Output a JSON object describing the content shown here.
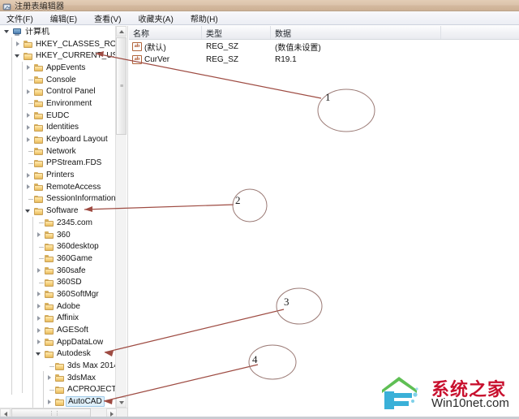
{
  "window": {
    "title": "注册表编辑器",
    "icon": "registry-editor-icon"
  },
  "menubar": {
    "items": [
      {
        "label": "文件(F)",
        "name": "menu-file"
      },
      {
        "label": "编辑(E)",
        "name": "menu-edit"
      },
      {
        "label": "查看(V)",
        "name": "menu-view"
      },
      {
        "label": "收藏夹(A)",
        "name": "menu-favorites"
      },
      {
        "label": "帮助(H)",
        "name": "menu-help"
      }
    ]
  },
  "tree": {
    "items": [
      {
        "label": "计算机",
        "indent": 0,
        "state": "expanded",
        "icon": "computer-icon",
        "selected": false
      },
      {
        "label": "HKEY_CLASSES_ROOT",
        "indent": 1,
        "state": "collapsed",
        "icon": "folder-icon",
        "selected": false
      },
      {
        "label": "HKEY_CURRENT_USER",
        "indent": 1,
        "state": "expanded",
        "icon": "folder-icon",
        "selected": false
      },
      {
        "label": "AppEvents",
        "indent": 2,
        "state": "collapsed",
        "icon": "folder-icon",
        "selected": false
      },
      {
        "label": "Console",
        "indent": 2,
        "state": "leaf",
        "icon": "folder-icon",
        "selected": false
      },
      {
        "label": "Control Panel",
        "indent": 2,
        "state": "collapsed",
        "icon": "folder-icon",
        "selected": false
      },
      {
        "label": "Environment",
        "indent": 2,
        "state": "leaf",
        "icon": "folder-icon",
        "selected": false
      },
      {
        "label": "EUDC",
        "indent": 2,
        "state": "collapsed",
        "icon": "folder-icon",
        "selected": false
      },
      {
        "label": "Identities",
        "indent": 2,
        "state": "collapsed",
        "icon": "folder-icon",
        "selected": false
      },
      {
        "label": "Keyboard Layout",
        "indent": 2,
        "state": "collapsed",
        "icon": "folder-icon",
        "selected": false
      },
      {
        "label": "Network",
        "indent": 2,
        "state": "leaf",
        "icon": "folder-icon",
        "selected": false
      },
      {
        "label": "PPStream.FDS",
        "indent": 2,
        "state": "leaf",
        "icon": "folder-icon",
        "selected": false
      },
      {
        "label": "Printers",
        "indent": 2,
        "state": "collapsed",
        "icon": "folder-icon",
        "selected": false
      },
      {
        "label": "RemoteAccess",
        "indent": 2,
        "state": "collapsed",
        "icon": "folder-icon",
        "selected": false
      },
      {
        "label": "SessionInformation",
        "indent": 2,
        "state": "leaf",
        "icon": "folder-icon",
        "selected": false
      },
      {
        "label": "Software",
        "indent": 2,
        "state": "expanded",
        "icon": "folder-icon",
        "selected": false
      },
      {
        "label": "2345.com",
        "indent": 3,
        "state": "leaf",
        "icon": "folder-icon",
        "selected": false
      },
      {
        "label": "360",
        "indent": 3,
        "state": "collapsed",
        "icon": "folder-icon",
        "selected": false
      },
      {
        "label": "360desktop",
        "indent": 3,
        "state": "leaf",
        "icon": "folder-icon",
        "selected": false
      },
      {
        "label": "360Game",
        "indent": 3,
        "state": "leaf",
        "icon": "folder-icon",
        "selected": false
      },
      {
        "label": "360safe",
        "indent": 3,
        "state": "collapsed",
        "icon": "folder-icon",
        "selected": false
      },
      {
        "label": "360SD",
        "indent": 3,
        "state": "leaf",
        "icon": "folder-icon",
        "selected": false
      },
      {
        "label": "360SoftMgr",
        "indent": 3,
        "state": "collapsed",
        "icon": "folder-icon",
        "selected": false
      },
      {
        "label": "Adobe",
        "indent": 3,
        "state": "collapsed",
        "icon": "folder-icon",
        "selected": false
      },
      {
        "label": "Affinix",
        "indent": 3,
        "state": "collapsed",
        "icon": "folder-icon",
        "selected": false
      },
      {
        "label": "AGESoft",
        "indent": 3,
        "state": "collapsed",
        "icon": "folder-icon",
        "selected": false
      },
      {
        "label": "AppDataLow",
        "indent": 3,
        "state": "collapsed",
        "icon": "folder-icon",
        "selected": false
      },
      {
        "label": "Autodesk",
        "indent": 3,
        "state": "expanded",
        "icon": "folder-icon",
        "selected": false
      },
      {
        "label": "3ds Max 2014",
        "indent": 4,
        "state": "leaf",
        "icon": "folder-icon",
        "selected": false
      },
      {
        "label": "3dsMax",
        "indent": 4,
        "state": "collapsed",
        "icon": "folder-icon",
        "selected": false
      },
      {
        "label": "ACPROJECT",
        "indent": 4,
        "state": "leaf",
        "icon": "folder-icon",
        "selected": false
      },
      {
        "label": "AutoCAD",
        "indent": 4,
        "state": "collapsed",
        "icon": "folder-icon",
        "selected": true
      }
    ]
  },
  "list": {
    "columns": [
      {
        "label": "名称",
        "name": "column-name"
      },
      {
        "label": "类型",
        "name": "column-type"
      },
      {
        "label": "数据",
        "name": "column-data"
      }
    ],
    "rows": [
      {
        "name": "(默认)",
        "type": "REG_SZ",
        "data": "(数值未设置)",
        "icon": "string-value-icon"
      },
      {
        "name": "CurVer",
        "type": "REG_SZ",
        "data": "R19.1",
        "icon": "string-value-icon"
      }
    ]
  },
  "annotations": {
    "color": "#9e4b42",
    "markers": [
      {
        "label": "1",
        "name": "annotation-marker-1"
      },
      {
        "label": "2",
        "name": "annotation-marker-2"
      },
      {
        "label": "3",
        "name": "annotation-marker-3"
      },
      {
        "label": "4",
        "name": "annotation-marker-4"
      }
    ]
  },
  "watermark": {
    "chinese": "系统之家",
    "english": "Win10net.com",
    "accent": "#c8102e",
    "logo_color": "#3ab0d8"
  }
}
